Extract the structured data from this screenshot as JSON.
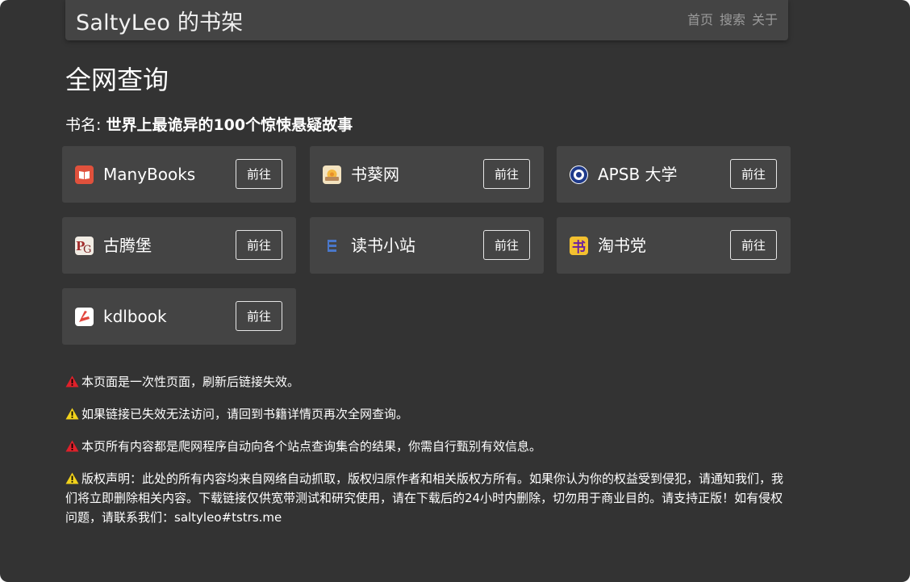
{
  "header": {
    "brand": "SaltyLeo 的书架",
    "nav": [
      "首页",
      "搜索",
      "关于"
    ]
  },
  "page": {
    "title": "全网查询",
    "book_label": "书名: ",
    "book_name": "世界上最诡异的100个惊悚悬疑故事"
  },
  "sites": [
    {
      "name": "ManyBooks",
      "button": "前往",
      "icon": "manybooks-icon",
      "color": "#e0513c"
    },
    {
      "name": "书葵网",
      "button": "前往",
      "icon": "shukui-icon",
      "color": "#f5c56a"
    },
    {
      "name": "APSB 大学",
      "button": "前往",
      "icon": "apsb-icon",
      "color": "#1f3a8a"
    },
    {
      "name": "古腾堡",
      "button": "前往",
      "icon": "gutenberg-icon",
      "color": "#b03030"
    },
    {
      "name": "读书小站",
      "button": "前往",
      "icon": "dushu-icon",
      "color": "#4a77c9"
    },
    {
      "name": "淘书党",
      "button": "前往",
      "icon": "taoshudang-icon",
      "color": "#f3c02f"
    },
    {
      "name": "kdlbook",
      "button": "前往",
      "icon": "kdlbook-icon",
      "color": "#e2453c"
    }
  ],
  "notices": [
    {
      "level": "red",
      "text": "本页面是一次性页面，刷新后链接失效。"
    },
    {
      "level": "yellow",
      "text": "如果链接已失效无法访问，请回到书籍详情页再次全网查询。"
    },
    {
      "level": "red",
      "text": "本页所有内容都是爬网程序自动向各个站点查询集合的结果，你需自行甄别有效信息。"
    },
    {
      "level": "yellow",
      "text": "版权声明：此处的所有内容均来自网络自动抓取，版权归原作者和相关版权方所有。如果你认为你的权益受到侵犯，请通知我们，我们将立即删除相关内容。下载链接仅供宽带测试和研究使用，请在下载后的24小时内删除，切勿用于商业目的。请支持正版！如有侵权问题，请联系我们：saltyleo#tstrs.me"
    }
  ],
  "colors": {
    "background": "#333333",
    "card": "#444444",
    "warn_red": "#e0202a",
    "warn_yellow": "#f2d21b"
  }
}
